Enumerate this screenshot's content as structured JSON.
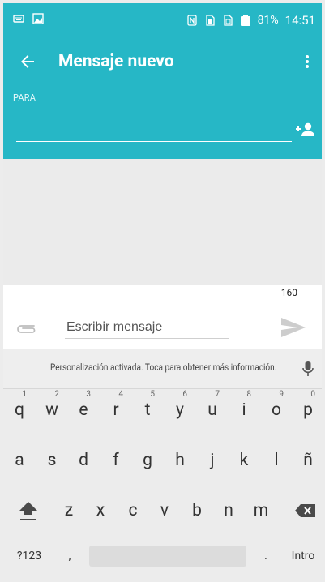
{
  "status_bar": {
    "battery": "81%",
    "time": "14:51",
    "icons": [
      "keyboard-icon",
      "image-icon",
      "nfc-icon",
      "sim-1-icon",
      "sim-2-icon",
      "battery-icon"
    ]
  },
  "toolbar": {
    "title": "Mensaje nuevo",
    "back_icon": "arrow-left-icon",
    "overflow_icon": "overflow-menu-icon"
  },
  "recipient": {
    "label": "PARA",
    "value": "",
    "add_contact_icon": "add-contact-icon"
  },
  "compose": {
    "char_count": "160",
    "placeholder": "Escribir mensaje",
    "attach_icon": "paperclip-icon",
    "send_icon": "send-icon"
  },
  "keyboard": {
    "suggestion": "Personalización activada. Toca para obtener más información.",
    "mic_icon": "microphone-icon",
    "row1": [
      {
        "label": "q",
        "hint": "1"
      },
      {
        "label": "w",
        "hint": "2"
      },
      {
        "label": "e",
        "hint": "3"
      },
      {
        "label": "r",
        "hint": "4"
      },
      {
        "label": "t",
        "hint": "5"
      },
      {
        "label": "y",
        "hint": "6"
      },
      {
        "label": "u",
        "hint": "7"
      },
      {
        "label": "i",
        "hint": "8"
      },
      {
        "label": "o",
        "hint": "9"
      },
      {
        "label": "p",
        "hint": "0"
      }
    ],
    "row2": [
      "a",
      "s",
      "d",
      "f",
      "g",
      "h",
      "j",
      "k",
      "l",
      "ñ"
    ],
    "row3": [
      "z",
      "x",
      "c",
      "v",
      "b",
      "n",
      "m"
    ],
    "shift_icon": "shift-icon",
    "delete_icon": "backspace-icon",
    "symbols_label": "?123",
    "comma_label": ",",
    "period_label": ".",
    "enter_label": "Intro"
  }
}
